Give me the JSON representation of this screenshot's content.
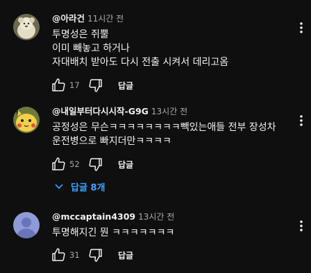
{
  "comments": [
    {
      "author": "@아라건",
      "time": "11시간 전",
      "lines": [
        "투명성은 쥐뿔",
        "이미 빼놓고 하거나",
        "자대배치 받아도 다시 전출 시켜서 데리고옴"
      ],
      "likes": "17",
      "reply_label": "답글",
      "avatar_color": "#c8bfa3"
    },
    {
      "author": "@내일부터다시시작-G9G",
      "time": "13시간 전",
      "lines": [
        "공정성은 무슨ㅋㅋㅋㅋㅋㅋㅋㅋ빽있는애들 전부 장성차",
        "운전병으로 빠지더만ㅋㅋㅋㅋ"
      ],
      "likes": "52",
      "reply_label": "답글",
      "replies_toggle": "답글 8개",
      "avatar_color": "#e9c84a"
    },
    {
      "author": "@mccaptain4309",
      "time": "13시간 전",
      "lines": [
        "투명해지긴 뭔 ㅋㅋㅋㅋㅋㅋㅋ"
      ],
      "likes": "31",
      "reply_label": "답글",
      "avatar_color": "#8f9ad9"
    }
  ],
  "colors": {
    "background": "#0f0f0f",
    "text": "#f1f1f1",
    "secondary": "#aaaaaa",
    "link": "#3ea6ff"
  },
  "icons": [
    "thumb-up-icon",
    "thumb-down-icon",
    "more-vert-icon",
    "chevron-down-icon"
  ]
}
